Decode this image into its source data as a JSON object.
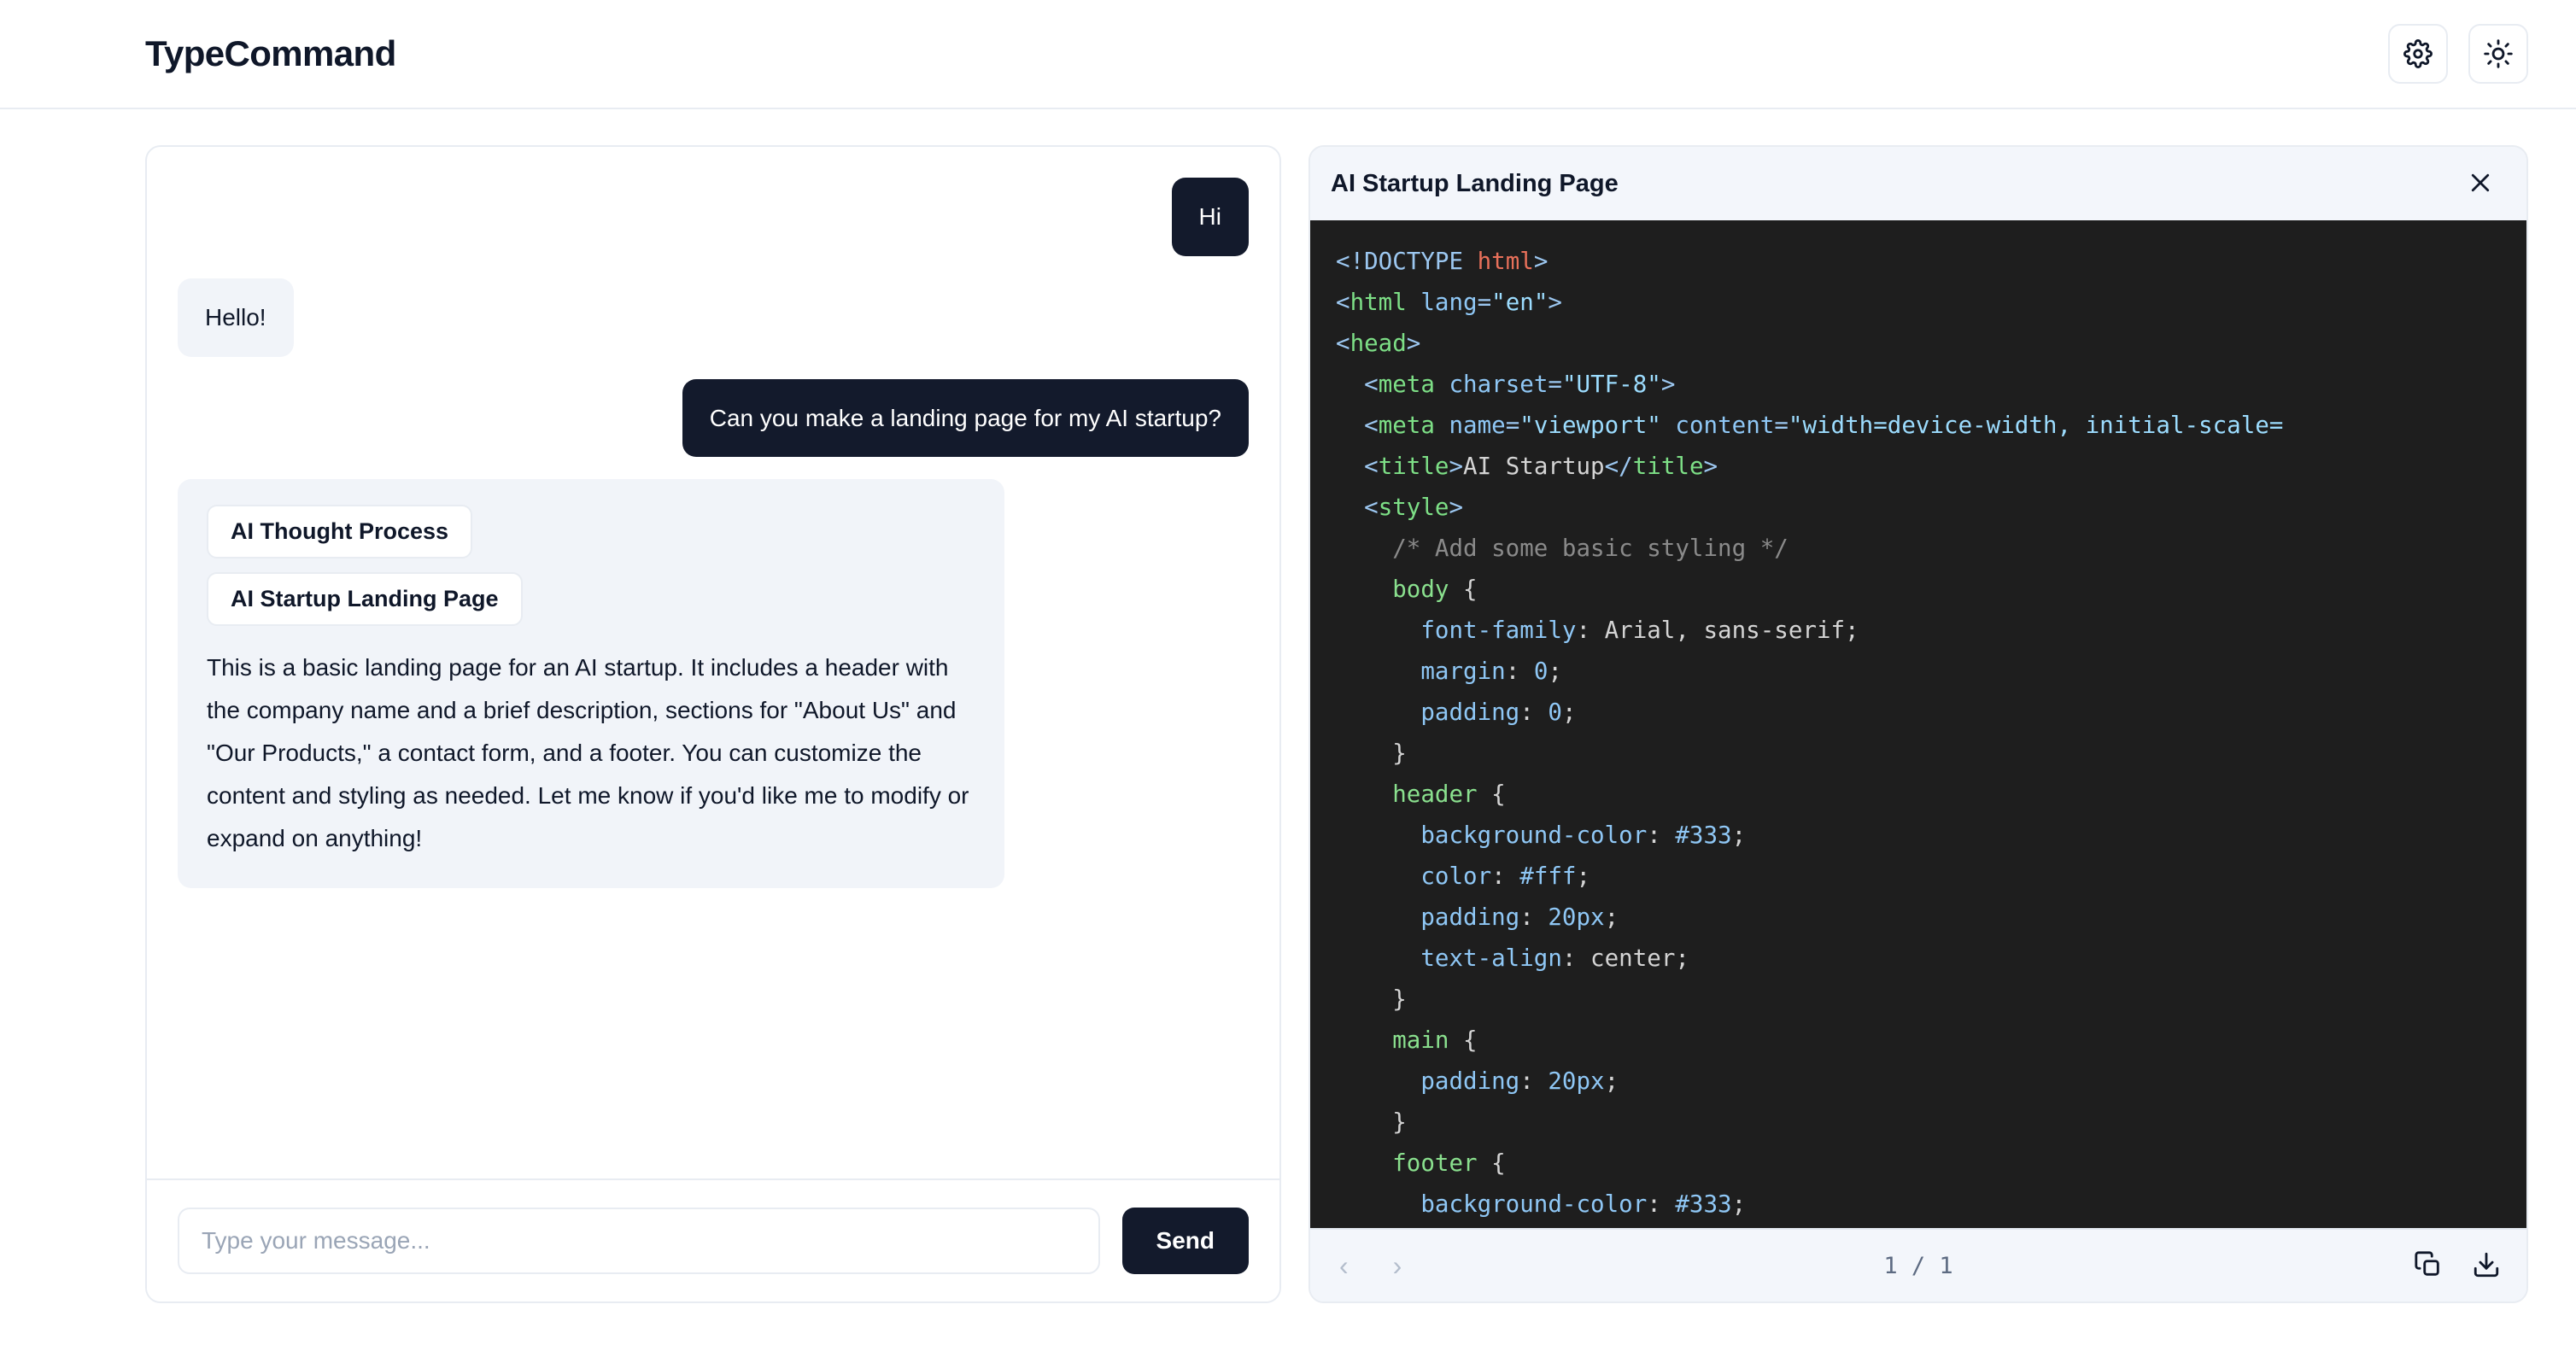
{
  "app": {
    "brand": "TypeCommand"
  },
  "topbar": {
    "settings_icon": "gear-icon",
    "theme_icon": "sun-icon"
  },
  "chat": {
    "messages": [
      {
        "role": "user",
        "text": "Hi"
      },
      {
        "role": "ai",
        "text": "Hello!"
      },
      {
        "role": "user",
        "text": "Can you make a landing page for my AI startup?"
      }
    ],
    "rich_message": {
      "chips": [
        "AI Thought Process",
        "AI Startup Landing Page"
      ],
      "text": "This is a basic landing page for an AI startup. It includes a header with the company name and a brief description, sections for \"About Us\" and \"Our Products,\" a contact form, and a footer. You can customize the content and styling as needed. Let me know if you'd like me to modify or expand on anything!"
    },
    "input": {
      "value": "",
      "placeholder": "Type your message..."
    },
    "send_label": "Send"
  },
  "code_panel": {
    "title": "AI Startup Landing Page",
    "close_icon": "close-icon",
    "page_indicator": "1 / 1",
    "prev_label": "‹",
    "next_label": "›",
    "copy_icon": "copy-icon",
    "download_icon": "download-icon",
    "language": "html",
    "code_lines": [
      "<!DOCTYPE html>",
      "<html lang=\"en\">",
      "<head>",
      "  <meta charset=\"UTF-8\">",
      "  <meta name=\"viewport\" content=\"width=device-width, initial-scale=",
      "  <title>AI Startup</title>",
      "  <style>",
      "    /* Add some basic styling */",
      "    body {",
      "      font-family: Arial, sans-serif;",
      "      margin: 0;",
      "      padding: 0;",
      "    }",
      "    header {",
      "      background-color: #333;",
      "      color: #fff;",
      "      padding: 20px;",
      "      text-align: center;",
      "    }",
      "    main {",
      "      padding: 20px;",
      "    }",
      "    footer {",
      "      background-color: #333;"
    ]
  },
  "colors": {
    "accent_dark": "#131a2c",
    "panel_bg": "#f3f6fb",
    "code_bg": "#1e1e1e",
    "border": "#e8ecf2",
    "ai_bubble": "#f1f4f9"
  }
}
